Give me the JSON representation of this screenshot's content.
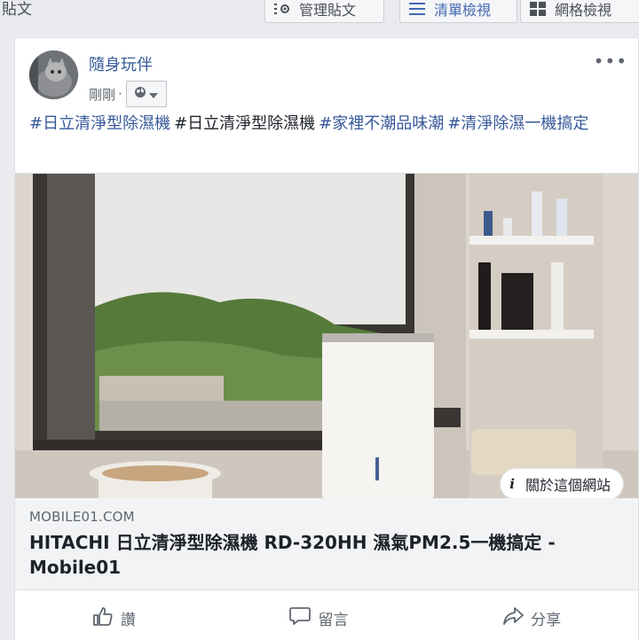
{
  "header": {
    "section_title": "貼文",
    "manage_label": "管理貼文",
    "list_view_label": "清單檢視",
    "grid_view_label": "網格檢視"
  },
  "post": {
    "author": "隨身玩伴",
    "timestamp": "剛剛",
    "separator": "·",
    "more": "•••",
    "hashtags": [
      "#日立清淨型除濕機",
      "#日立清淨型除濕機",
      "#家裡不潮品味潮",
      "#清淨除濕一機搞定"
    ],
    "link": {
      "domain": "MOBILE01.COM",
      "title": "HITACHI 日立清淨型除濕機 RD-320HH 濕氣PM2.5一機搞定 - Mobile01",
      "about_label": "關於這個網站",
      "about_icon": "i"
    },
    "actions": {
      "like": "讚",
      "comment": "留言",
      "share": "分享"
    }
  },
  "colors": {
    "link_blue": "#365899",
    "accent_blue": "#4267b2",
    "muted": "#606770"
  }
}
